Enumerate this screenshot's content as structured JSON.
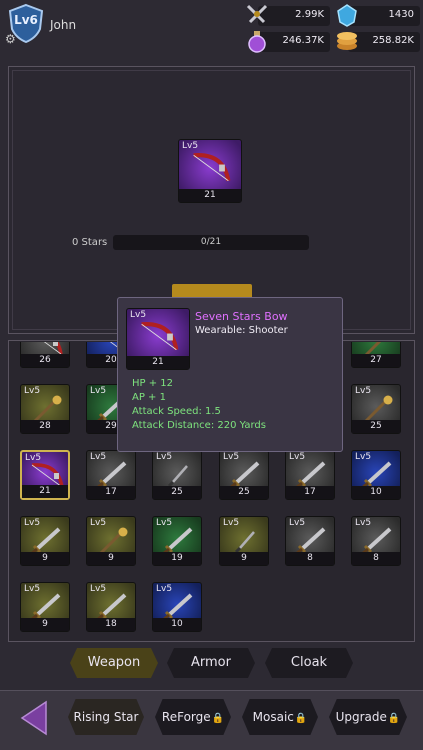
{
  "player": {
    "level": "Lv6",
    "name": "John"
  },
  "resources": {
    "swords": "2.99K",
    "gems": "1430",
    "potion": "246.37K",
    "coins": "258.82K"
  },
  "preview": {
    "level": "Lv5",
    "count": "21",
    "stars_label": "0 Stars",
    "stars_progress": "0/21",
    "progress_fraction": 0
  },
  "tooltip": {
    "level": "Lv5",
    "count": "21",
    "name": "Seven Stars Bow",
    "wearable": "Wearable:  Shooter",
    "stats": [
      "HP + 12",
      "AP + 1",
      "Attack Speed:  1.5",
      "Attack Distance: 220 Yards"
    ]
  },
  "inventory": {
    "partial_row": [
      {
        "count": "26",
        "bg": "gray",
        "item": "bow-icon"
      },
      {
        "count": "20",
        "bg": "blue",
        "item": "bow-icon"
      },
      {
        "count": "27",
        "bg": "green",
        "item": "staff-icon"
      }
    ],
    "row2": [
      {
        "level": "Lv5",
        "count": "28",
        "bg": "yellow",
        "item": "staff-icon"
      },
      {
        "level": "Lv5",
        "count": "29",
        "bg": "green",
        "item": "sword-icon"
      },
      {
        "level": "Lv5",
        "count": "25",
        "bg": "gray",
        "item": "staff-icon"
      }
    ],
    "row3": [
      {
        "level": "Lv5",
        "count": "21",
        "bg": "purple",
        "item": "bow-icon",
        "selected": true
      },
      {
        "level": "Lv5",
        "count": "17",
        "bg": "gray",
        "item": "sword-icon"
      },
      {
        "level": "Lv5",
        "count": "25",
        "bg": "gray",
        "item": "dagger-icon"
      },
      {
        "level": "Lv5",
        "count": "25",
        "bg": "gray",
        "item": "sword-icon"
      },
      {
        "level": "Lv5",
        "count": "17",
        "bg": "gray",
        "item": "sword-icon"
      },
      {
        "level": "Lv5",
        "count": "10",
        "bg": "blue",
        "item": "sword-icon"
      }
    ],
    "row4": [
      {
        "level": "Lv5",
        "count": "9",
        "bg": "yellow",
        "item": "sword-icon"
      },
      {
        "level": "Lv5",
        "count": "9",
        "bg": "yellow",
        "item": "staff-icon"
      },
      {
        "level": "Lv5",
        "count": "19",
        "bg": "green",
        "item": "sword-icon"
      },
      {
        "level": "Lv5",
        "count": "9",
        "bg": "yellow",
        "item": "dagger-icon"
      },
      {
        "level": "Lv5",
        "count": "8",
        "bg": "gray",
        "item": "sword-icon"
      },
      {
        "level": "Lv5",
        "count": "8",
        "bg": "gray",
        "item": "sword-icon"
      }
    ],
    "row5": [
      {
        "level": "Lv5",
        "count": "9",
        "bg": "yellow",
        "item": "sword-icon"
      },
      {
        "level": "Lv5",
        "count": "18",
        "bg": "yellow",
        "item": "sword-icon"
      },
      {
        "level": "Lv5",
        "count": "10",
        "bg": "blue",
        "item": "sword-icon"
      }
    ]
  },
  "tabs": [
    "Weapon",
    "Armor",
    "Cloak"
  ],
  "bottom_nav": [
    "Rising Star",
    "ReForge",
    "Mosaic",
    "Upgrade"
  ],
  "colors": {
    "accent_gold": "#cfb44f",
    "tooltip_name": "#e070ff",
    "stat_green": "#7ee37e"
  }
}
